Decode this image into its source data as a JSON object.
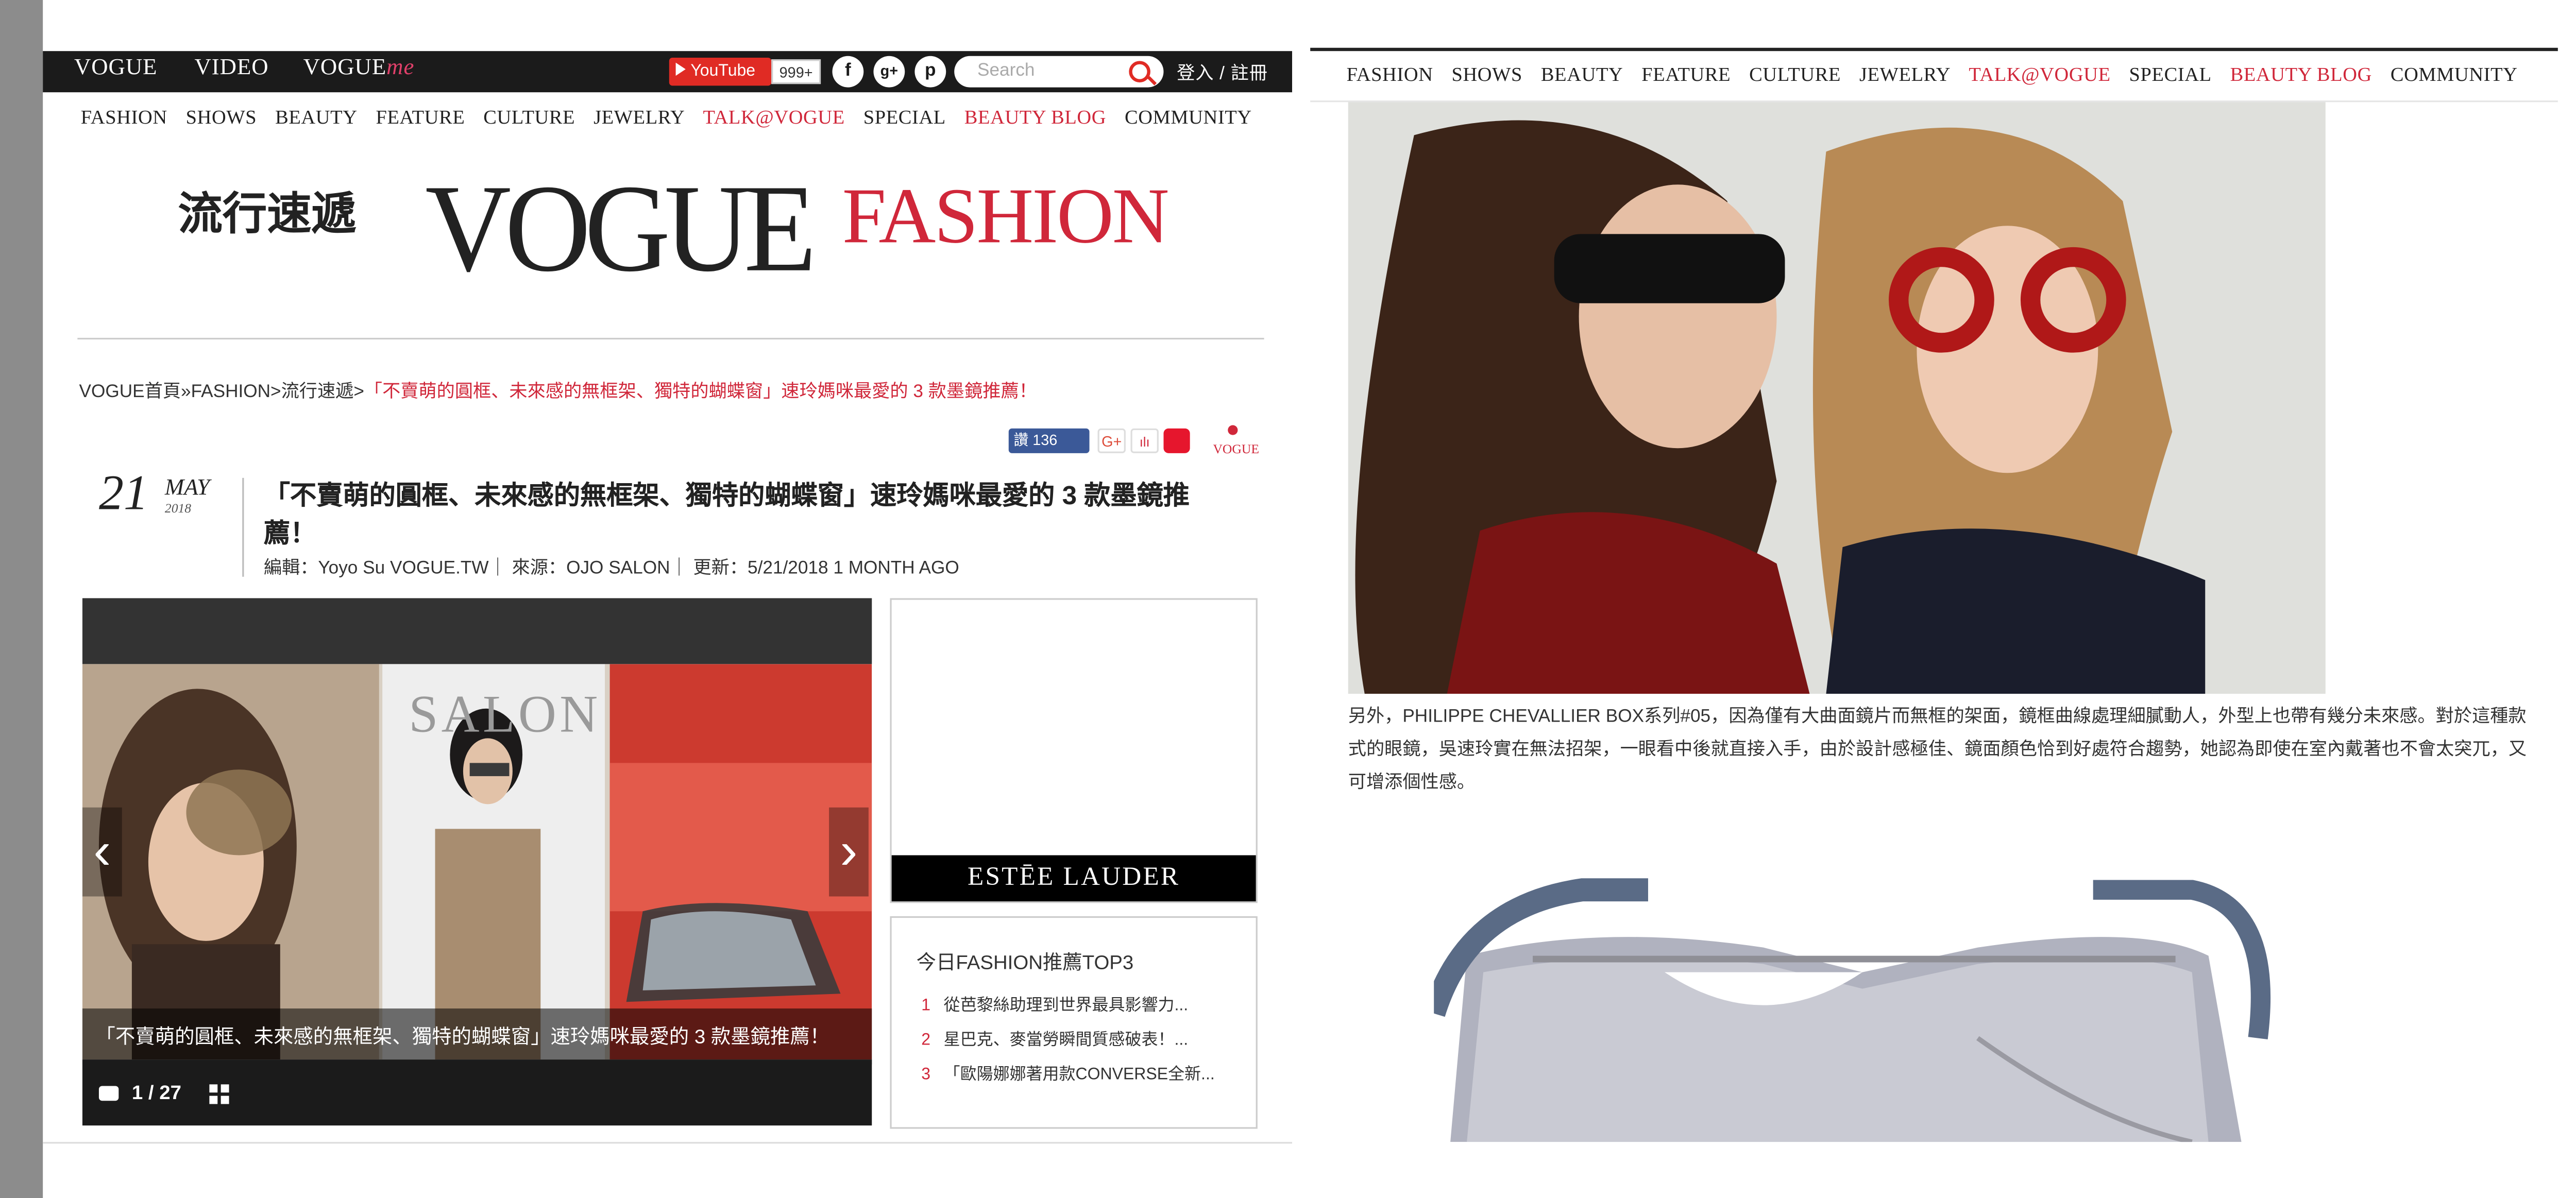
{
  "top_bar": {
    "links": [
      "VOGUE",
      "VIDEO"
    ],
    "vogueme": {
      "vogue": "VOGUE",
      "me": "me"
    },
    "youtube_label": "YouTube",
    "youtube_count": "999+",
    "search_placeholder": "Search",
    "login": "登入 / 註冊"
  },
  "nav": {
    "items": [
      "FASHION",
      "SHOWS",
      "BEAUTY",
      "FEATURE",
      "CULTURE",
      "JEWELRY",
      "TALK@VOGUE",
      "SPECIAL",
      "BEAUTY BLOG",
      "COMMUNITY"
    ],
    "highlight_color": "#d0273a"
  },
  "masthead": {
    "section_cn": "流行速遞",
    "brand": "VOGUE",
    "section_en": "FASHION"
  },
  "breadcrumb": {
    "prefix": "VOGUE首頁»FASHION>流行速遞>",
    "current": "「不賣萌的圓框、未來感的無框架、獨特的蝴蝶窗」速玲媽咪最愛的 3 款墨鏡推薦！"
  },
  "share": {
    "fb_label": "讚",
    "fb_count": "136",
    "gplus": "G+",
    "vogue_small": "VOGUE"
  },
  "article": {
    "day": "21",
    "month": "MAY",
    "year": "2018",
    "title": "「不賣萌的圓框、未來感的無框架、獨特的蝴蝶窗」速玲媽咪最愛的 3 款墨鏡推薦！",
    "meta": "編輯：Yoyo Su  VOGUE.TW｜ 來源：OJO SALON｜ 更新：5/21/2018  1 MONTH AGO"
  },
  "slider": {
    "caption": "「不賣萌的圓框、未來感的無框架、獨特的蝴蝶窗」速玲媽咪最愛的 3 款墨鏡推薦！",
    "counter": "1 / 27",
    "watermark": "SALON"
  },
  "ad": {
    "brand": "ESTĒE LAUDER"
  },
  "top3": {
    "heading": "今日FASHION推薦TOP3",
    "items": [
      {
        "rank": "1",
        "text": "從芭黎絲助理到世界最具影響力..."
      },
      {
        "rank": "2",
        "text": "星巴克、麥當勞瞬間質感破表！..."
      },
      {
        "rank": "3",
        "text": "「歐陽娜娜著用款CONVERSE全新..."
      }
    ]
  },
  "right_body": {
    "paragraph": "另外，PHILIPPE CHEVALLIER BOX系列#05，因為僅有大曲面鏡片而無框的架面，鏡框曲線處理細膩動人，外型上也帶有幾分未來感。對於這種款式的眼鏡，吳速玲實在無法招架，一眼看中後就直接入手，由於設計感極佳、鏡面顏色恰到好處符合趨勢，她認為即使在室內戴著也不會太突兀，又可增添個性感。"
  }
}
